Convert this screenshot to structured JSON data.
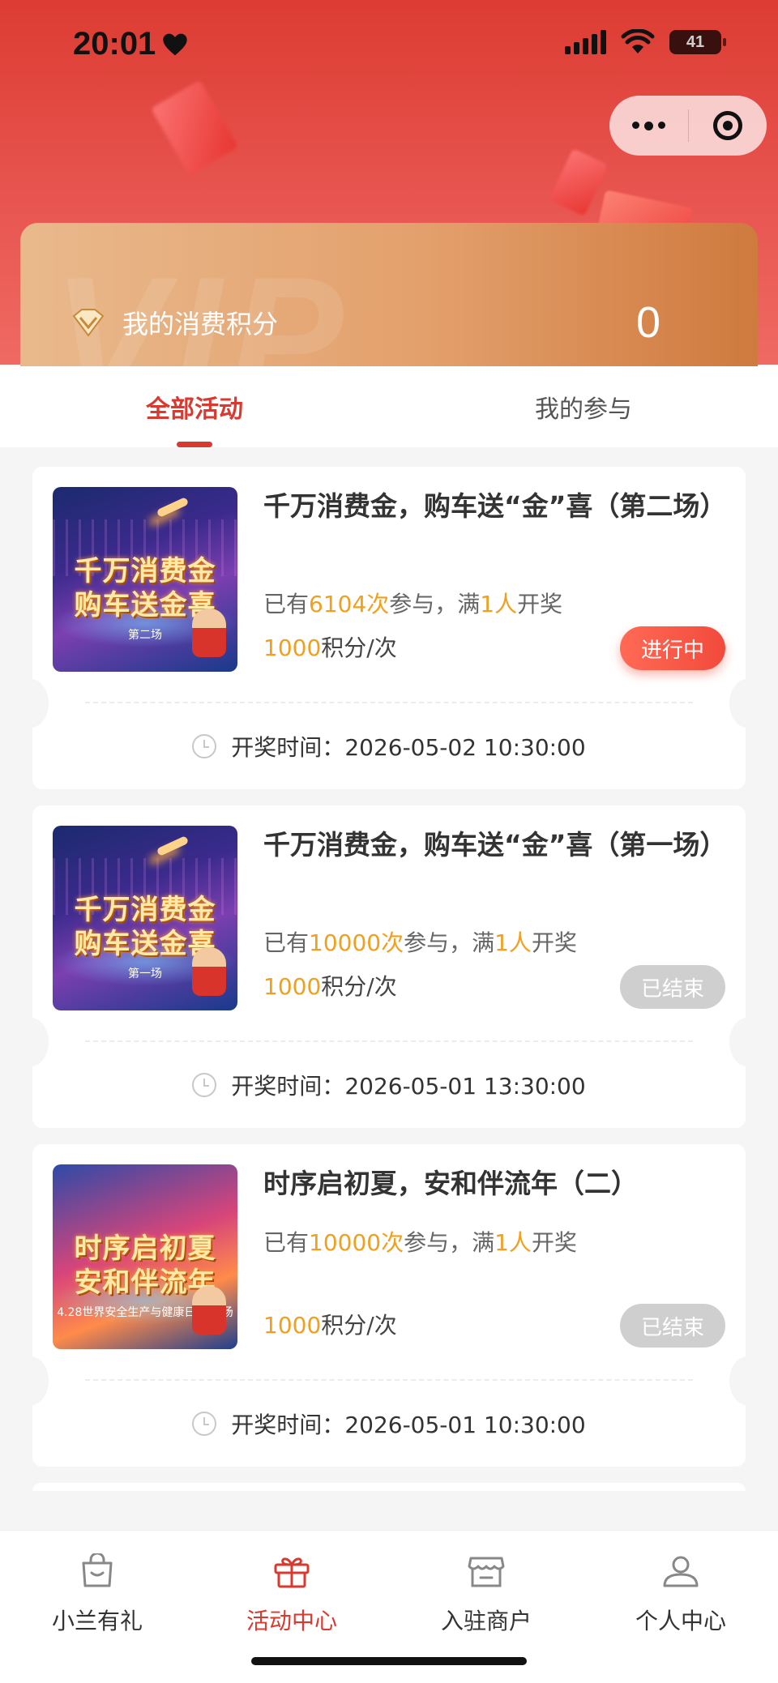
{
  "status_bar": {
    "time": "20:01",
    "battery": "41"
  },
  "vip": {
    "watermark": "VIP",
    "label": "我的消费积分",
    "value": "0"
  },
  "tabs": [
    {
      "label": "全部活动",
      "active": true
    },
    {
      "label": "我的参与",
      "active": false
    }
  ],
  "activities": [
    {
      "title": "千万消费金，购车送“金”喜（第二场）",
      "thumb_line1": "千万消费金",
      "thumb_line2": "购车送金喜",
      "thumb_sub": "第二场",
      "participants_prefix": "已有",
      "participants_count": "6104次",
      "participants_mid": "参与，满",
      "threshold": "1人",
      "participants_suffix": "开奖",
      "cost_value": "1000",
      "cost_unit": "积分/次",
      "status": "进行中",
      "draw_label": "开奖时间：",
      "draw_time": "2026-05-02 10:30:00"
    },
    {
      "title": "千万消费金，购车送“金”喜（第一场）",
      "thumb_line1": "千万消费金",
      "thumb_line2": "购车送金喜",
      "thumb_sub": "第一场",
      "participants_prefix": "已有",
      "participants_count": "10000次",
      "participants_mid": "参与，满",
      "threshold": "1人",
      "participants_suffix": "开奖",
      "cost_value": "1000",
      "cost_unit": "积分/次",
      "status": "已结束",
      "draw_label": "开奖时间：",
      "draw_time": "2026-05-01 13:30:00"
    },
    {
      "title": "时序启初夏，安和伴流年（二）",
      "thumb_line1": "时序启初夏",
      "thumb_line2": "安和伴流年",
      "thumb_sub": "4.28世界安全生产与健康日 第二场",
      "participants_prefix": "已有",
      "participants_count": "10000次",
      "participants_mid": "参与，满",
      "threshold": "1人",
      "participants_suffix": "开奖",
      "cost_value": "1000",
      "cost_unit": "积分/次",
      "status": "已结束",
      "draw_label": "开奖时间：",
      "draw_time": "2026-05-01 10:30:00"
    }
  ],
  "bottom_nav": [
    {
      "label": "小兰有礼",
      "icon": "shopping-bag-icon"
    },
    {
      "label": "活动中心",
      "icon": "gift-icon",
      "active": true
    },
    {
      "label": "入驻商户",
      "icon": "store-icon"
    },
    {
      "label": "个人中心",
      "icon": "user-icon"
    }
  ],
  "colors": {
    "primary": "#d93a30",
    "highlight": "#f0a020",
    "ended": "#cfcfcf"
  }
}
